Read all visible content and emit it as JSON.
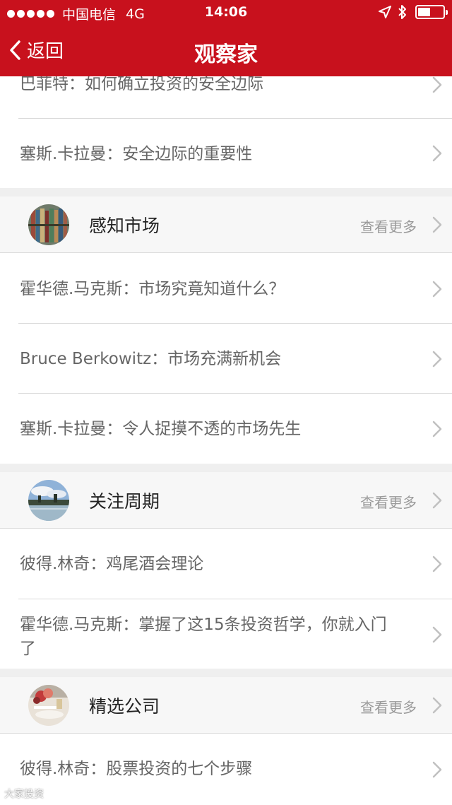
{
  "status_bar": {
    "carrier": "中国电信",
    "network": "4G",
    "time": "14:06"
  },
  "nav": {
    "back_label": "返回",
    "title": "观察家"
  },
  "top_items": [
    {
      "text": "巴菲特：如何确立投资的安全边际"
    },
    {
      "text": "塞斯.卡拉曼：安全边际的重要性"
    }
  ],
  "sections": [
    {
      "title": "感知市场",
      "more_label": "查看更多",
      "items": [
        {
          "text": "霍华德.马克斯：市场究竟知道什么？"
        },
        {
          "text": "Bruce Berkowitz：市场充满新机会"
        },
        {
          "text": "塞斯.卡拉曼：令人捉摸不透的市场先生"
        }
      ]
    },
    {
      "title": "关注周期",
      "more_label": "查看更多",
      "items": [
        {
          "text": "彼得.林奇：鸡尾酒会理论"
        },
        {
          "text": "霍华德.马克斯：掌握了这15条投资哲学，你就入门了"
        }
      ]
    },
    {
      "title": "精选公司",
      "more_label": "查看更多",
      "items": [
        {
          "text": "彼得.林奇：股票投资的七个步骤"
        }
      ]
    }
  ],
  "watermark": "大家投资"
}
